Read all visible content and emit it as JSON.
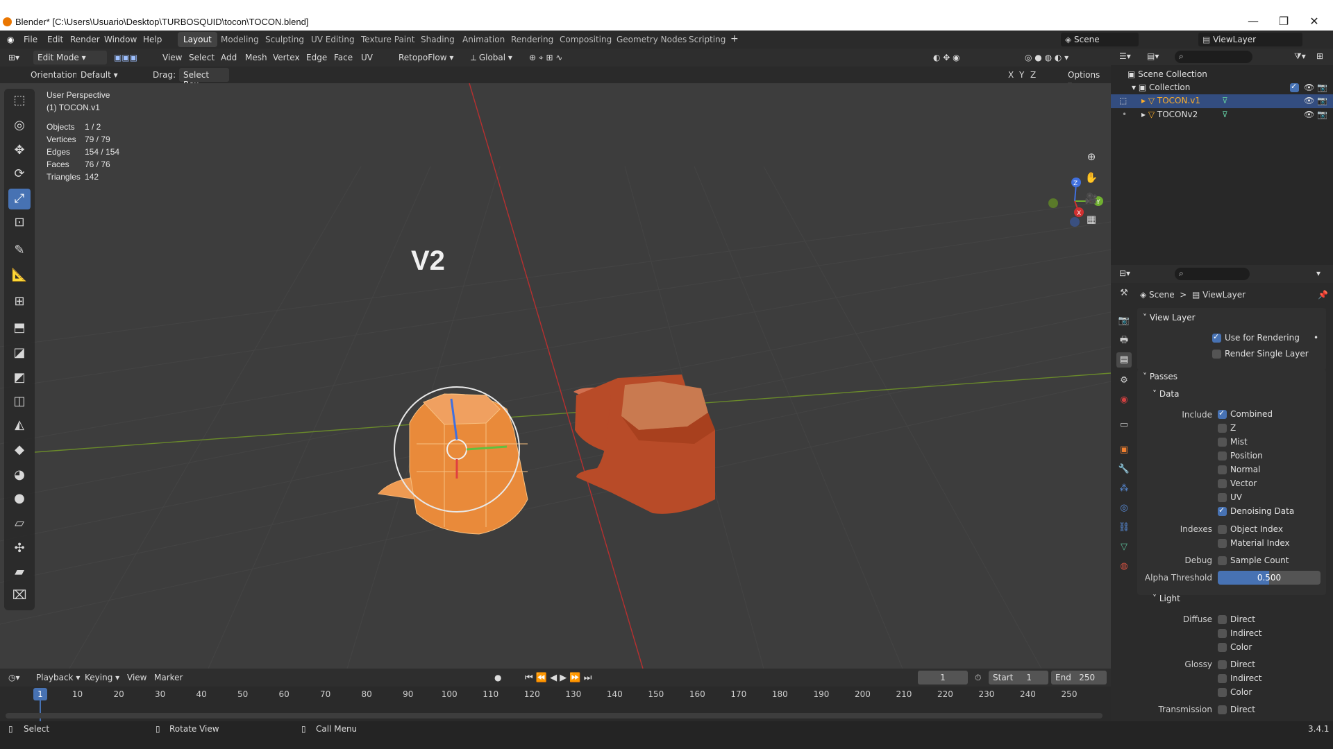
{
  "window": {
    "title": "Blender* [C:\\Users\\Usuario\\Desktop\\TURBOSQUID\\tocon\\TOCON.blend]"
  },
  "menu": [
    "File",
    "Edit",
    "Render",
    "Window",
    "Help"
  ],
  "workspaces": [
    "Layout",
    "Modeling",
    "Sculpting",
    "UV Editing",
    "Texture Paint",
    "Shading",
    "Animation",
    "Rendering",
    "Compositing",
    "Geometry Nodes",
    "Scripting"
  ],
  "scene": {
    "label": "Scene",
    "view_layer": "ViewLayer"
  },
  "header": {
    "mode": "Edit Mode",
    "items": [
      "View",
      "Select",
      "Add",
      "Mesh",
      "Vertex",
      "Edge",
      "Face",
      "UV"
    ],
    "addon": "RetopoFlow",
    "transform": "Global"
  },
  "header2": {
    "orientation_label": "Orientation:",
    "orientation_value": "Default",
    "drag_label": "Drag:",
    "drag_value": "Select Box",
    "options": "Options",
    "axes": [
      "X",
      "Y",
      "Z"
    ]
  },
  "viewport": {
    "perspective": "User Perspective",
    "object": "(1) TOCON.v1",
    "stats": [
      {
        "label": "Objects",
        "value": "1 / 2"
      },
      {
        "label": "Vertices",
        "value": "79 / 79"
      },
      {
        "label": "Edges",
        "value": "154 / 154"
      },
      {
        "label": "Faces",
        "value": "76 / 76"
      },
      {
        "label": "Triangles",
        "value": "142"
      }
    ],
    "overlay_text": "V2"
  },
  "outliner": {
    "root": "Scene Collection",
    "collection": "Collection",
    "objects": [
      "TOCON.v1",
      "TOCONv2"
    ]
  },
  "properties": {
    "breadcrumb": [
      "Scene",
      "ViewLayer"
    ],
    "view_layer_section": "View Layer",
    "use_for_rendering": "Use for Rendering",
    "render_single_layer": "Render Single Layer",
    "passes": "Passes",
    "data": "Data",
    "include_label": "Include",
    "include": [
      {
        "label": "Combined",
        "on": true
      },
      {
        "label": "Z",
        "on": false
      },
      {
        "label": "Mist",
        "on": false
      },
      {
        "label": "Position",
        "on": false
      },
      {
        "label": "Normal",
        "on": false
      },
      {
        "label": "Vector",
        "on": false
      },
      {
        "label": "UV",
        "on": false
      },
      {
        "label": "Denoising Data",
        "on": true
      }
    ],
    "indexes_label": "Indexes",
    "indexes": [
      "Object Index",
      "Material Index"
    ],
    "debug_label": "Debug",
    "debug": "Sample Count",
    "alpha_label": "Alpha Threshold",
    "alpha_value": "0.500",
    "light": "Light",
    "diffuse_label": "Diffuse",
    "diffuse": [
      "Direct",
      "Indirect",
      "Color"
    ],
    "glossy_label": "Glossy",
    "glossy": [
      "Direct",
      "Indirect",
      "Color"
    ],
    "transmission_label": "Transmission",
    "transmission": "Direct"
  },
  "timeline": {
    "menus": [
      "Playback",
      "Keying",
      "View",
      "Marker"
    ],
    "current_frame": "1",
    "start_label": "Start",
    "start": "1",
    "end_label": "End",
    "end": "250",
    "ticks": [
      "1",
      "10",
      "20",
      "30",
      "40",
      "50",
      "60",
      "70",
      "80",
      "90",
      "100",
      "110",
      "120",
      "130",
      "140",
      "150",
      "160",
      "170",
      "180",
      "190",
      "200",
      "210",
      "220",
      "230",
      "240",
      "250"
    ]
  },
  "statusbar": {
    "items": [
      "Select",
      "Rotate View",
      "Call Menu"
    ],
    "version": "3.4.1"
  },
  "colors": {
    "accent": "#4772b3",
    "mesh_orange": "#e8883a",
    "stump": "#c8552e"
  }
}
